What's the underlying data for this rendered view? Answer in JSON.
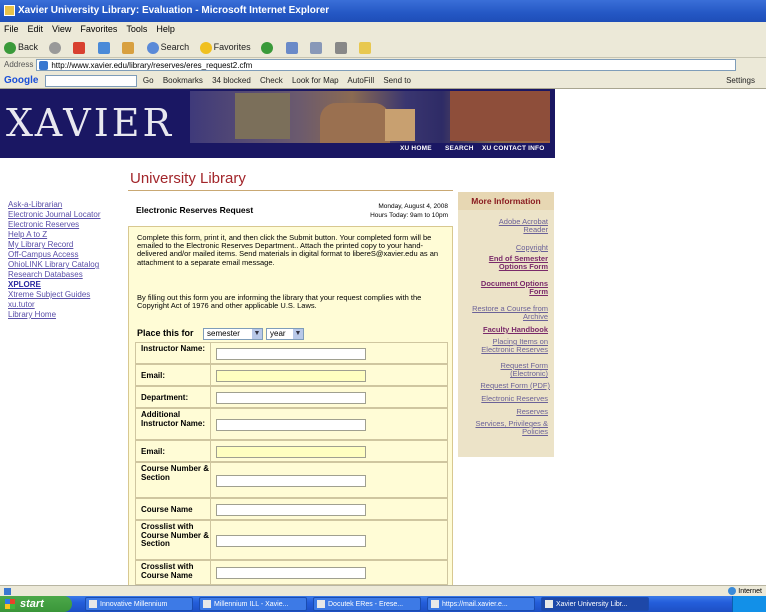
{
  "window": {
    "title": "Xavier University Library: Evaluation - Microsoft Internet Explorer"
  },
  "menu": [
    "File",
    "Edit",
    "View",
    "Favorites",
    "Tools",
    "Help"
  ],
  "toolbar": {
    "back": "Back",
    "search": "Search",
    "favorites": "Favorites"
  },
  "address": {
    "label": "Address",
    "url": "http://www.xavier.edu/library/reserves/eres_request2.cfm"
  },
  "googlebar": {
    "logo": "Google",
    "go": "Go",
    "bookmarks": "Bookmarks",
    "blocked": "34 blocked",
    "check": "Check",
    "lookfor": "Look for Map",
    "autofill": "AutoFill",
    "sendto": "Send to",
    "settings": "Settings"
  },
  "banner": {
    "logo": "XAVIER",
    "nav": [
      "XU HOME",
      "SEARCH",
      "XU CONTACT INFO"
    ]
  },
  "page": {
    "title": "University Library",
    "form_title": "Electronic Reserves Request",
    "date": "Monday, August 4, 2008",
    "hours": "Hours Today: 9am to 10pm",
    "para1": "Complete this form, print it, and then click the Submit button. Your completed form will be emailed to the Electronic Reserves Department.. Attach the printed copy to your hand-delivered and/or mailed items. Send materials in digital format to libereS@xavier.edu as an attachment to a separate email message.",
    "para2": "By filling out this form you are informing the library that your request complies with the Copyright Act of 1976 and other applicable U.S. Laws.",
    "place_label": "Place this for",
    "semester": "semester",
    "year": "year"
  },
  "sidebar": [
    {
      "label": "Ask-a-Librarian"
    },
    {
      "label": "Electronic Journal Locator"
    },
    {
      "label": "Electronic Reserves"
    },
    {
      "label": "Help A to Z"
    },
    {
      "label": "My Library Record"
    },
    {
      "label": "Off-Campus Access"
    },
    {
      "label": "OhioLINK Library Catalog"
    },
    {
      "label": "Research Databases"
    },
    {
      "label": "XPLORE"
    },
    {
      "label": "Xtreme Subject Guides"
    },
    {
      "label": "xu.tutor"
    },
    {
      "label": "Library Home"
    }
  ],
  "form_fields": [
    {
      "label": "Instructor Name:"
    },
    {
      "label": "Email:"
    },
    {
      "label": "Department:"
    },
    {
      "label": "Additional Instructor Name:"
    },
    {
      "label": "Email:"
    },
    {
      "label": "Course Number & Section"
    },
    {
      "label": "Course Name"
    },
    {
      "label": "Crosslist with Course Number & Section"
    },
    {
      "label": "Crosslist with Course Name"
    }
  ],
  "more_info": {
    "heading": "More Information",
    "links": [
      "Adobe Acrobat Reader",
      "Copyright",
      "End of Semester Options Form",
      "Document Options Form",
      "Restore a Course from Archive",
      "Faculty Handbook",
      "Placing Items on Electronic Reserves",
      "Request Form (Electronic)",
      "Request Form (PDF)",
      "Electronic Reserves",
      "Reserves",
      "Services, Privileges & Policies"
    ]
  },
  "status": {
    "zone": "Internet"
  },
  "taskbar": {
    "start": "start",
    "tasks": [
      "Innovative Millennium",
      "Millennium ILL - Xavie...",
      "Docutek ERes - Erese...",
      "https://mail.xavier.e...",
      "Xavier University Libr..."
    ]
  }
}
